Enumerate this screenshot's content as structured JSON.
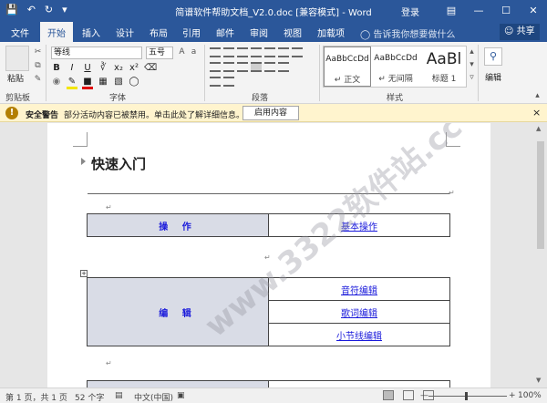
{
  "titlebar": {
    "title": "简谱软件帮助文档_V2.0.doc [兼容模式] - Word",
    "login": "登录",
    "qat_icons": [
      "save-icon",
      "undo-icon",
      "redo-icon",
      "customize-icon"
    ],
    "colors": {
      "bar": "#2b579a"
    }
  },
  "tabs": {
    "items": [
      "文件",
      "开始",
      "插入",
      "设计",
      "布局",
      "引用",
      "邮件",
      "审阅",
      "视图",
      "加载项"
    ],
    "active": "开始",
    "tell_me": "告诉我你想要做什么",
    "share": "共享"
  },
  "ribbon": {
    "clipboard": {
      "paste": "粘贴",
      "group": "剪贴板"
    },
    "font": {
      "name": "等线",
      "size": "五号",
      "group": "字体",
      "bold": "B",
      "italic": "I",
      "underline": "U"
    },
    "paragraph": {
      "group": "段落"
    },
    "styles": {
      "group": "样式",
      "items": [
        {
          "preview": "AaBbCcDd",
          "name": "↵ 正文"
        },
        {
          "preview": "AaBbCcDd",
          "name": "↵ 无间隔"
        },
        {
          "preview": "AaBl",
          "name": "标题 1"
        }
      ]
    },
    "editing": {
      "label": "编辑"
    }
  },
  "security_warning": {
    "title": "安全警告",
    "message": "部分活动内容已被禁用。单击此处了解详细信息。",
    "button": "启用内容",
    "close": "×"
  },
  "document": {
    "heading": "快速入门",
    "tables": [
      {
        "label": "操 作",
        "links": [
          "基本操作"
        ]
      },
      {
        "label": "编 辑",
        "links": [
          "音符编辑",
          "歌词编辑",
          "小节线编辑"
        ]
      }
    ],
    "watermark": "www.3322软件站.cc"
  },
  "status": {
    "page": "第 1 页，共 1 页",
    "words": "52 个字",
    "language": "中文(中国)",
    "zoom": "100%"
  }
}
